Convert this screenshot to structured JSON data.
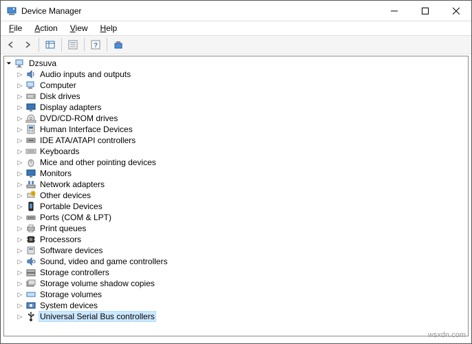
{
  "window": {
    "title": "Device Manager"
  },
  "menubar": {
    "items": [
      "File",
      "Action",
      "View",
      "Help"
    ]
  },
  "tree": {
    "root": "Dzsuva",
    "items": [
      {
        "label": "Audio inputs and outputs",
        "icon": "audio"
      },
      {
        "label": "Computer",
        "icon": "computer"
      },
      {
        "label": "Disk drives",
        "icon": "disk"
      },
      {
        "label": "Display adapters",
        "icon": "display"
      },
      {
        "label": "DVD/CD-ROM drives",
        "icon": "dvd"
      },
      {
        "label": "Human Interface Devices",
        "icon": "hid"
      },
      {
        "label": "IDE ATA/ATAPI controllers",
        "icon": "ide"
      },
      {
        "label": "Keyboards",
        "icon": "keyboard"
      },
      {
        "label": "Mice and other pointing devices",
        "icon": "mouse"
      },
      {
        "label": "Monitors",
        "icon": "monitor"
      },
      {
        "label": "Network adapters",
        "icon": "network"
      },
      {
        "label": "Other devices",
        "icon": "other"
      },
      {
        "label": "Portable Devices",
        "icon": "portable"
      },
      {
        "label": "Ports (COM & LPT)",
        "icon": "port"
      },
      {
        "label": "Print queues",
        "icon": "printer"
      },
      {
        "label": "Processors",
        "icon": "cpu"
      },
      {
        "label": "Software devices",
        "icon": "software"
      },
      {
        "label": "Sound, video and game controllers",
        "icon": "sound"
      },
      {
        "label": "Storage controllers",
        "icon": "storage"
      },
      {
        "label": "Storage volume shadow copies",
        "icon": "shadow"
      },
      {
        "label": "Storage volumes",
        "icon": "volume"
      },
      {
        "label": "System devices",
        "icon": "system"
      },
      {
        "label": "Universal Serial Bus controllers",
        "icon": "usb",
        "selected": true
      }
    ]
  },
  "watermark": "wsxdn.com"
}
